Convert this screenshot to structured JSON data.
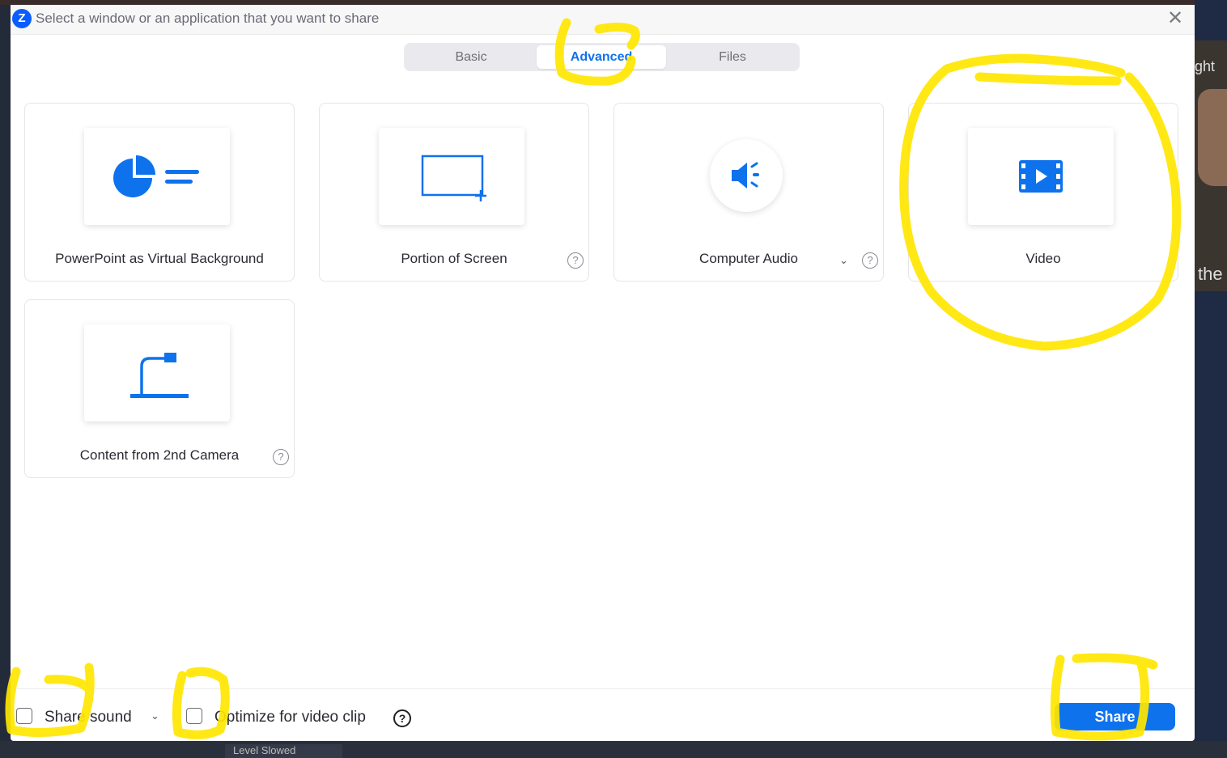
{
  "background": {
    "right_text_top": "ght",
    "right_text_mid": "the",
    "bottom_strip_text": "Level Slowed"
  },
  "dialog": {
    "app_icon_letter": "Z",
    "title": "Select a window or an application that you want to share",
    "close_glyph": "✕"
  },
  "tabs": [
    "Basic",
    "Advanced",
    "Files"
  ],
  "active_tab": "Advanced",
  "options": [
    {
      "label": "PowerPoint as Virtual Background",
      "icon": "powerpoint-background-icon"
    },
    {
      "label": "Portion of Screen",
      "icon": "screen-portion-icon",
      "help": "?"
    },
    {
      "label": "Computer Audio",
      "icon": "speaker-icon",
      "help": "?",
      "dropdown": "⌄"
    },
    {
      "label": "Video",
      "icon": "video-film-icon"
    },
    {
      "label": "Content from 2nd Camera",
      "icon": "document-camera-icon",
      "help": "?"
    }
  ],
  "footer": {
    "share_sound_label": "Share sound",
    "share_sound_chevron": "⌄",
    "optimize_label": "Optimize for video clip",
    "help_glyph": "?",
    "share_button": "Share"
  },
  "colors": {
    "accent": "#0e72ed",
    "annotation": "#ffe600"
  }
}
